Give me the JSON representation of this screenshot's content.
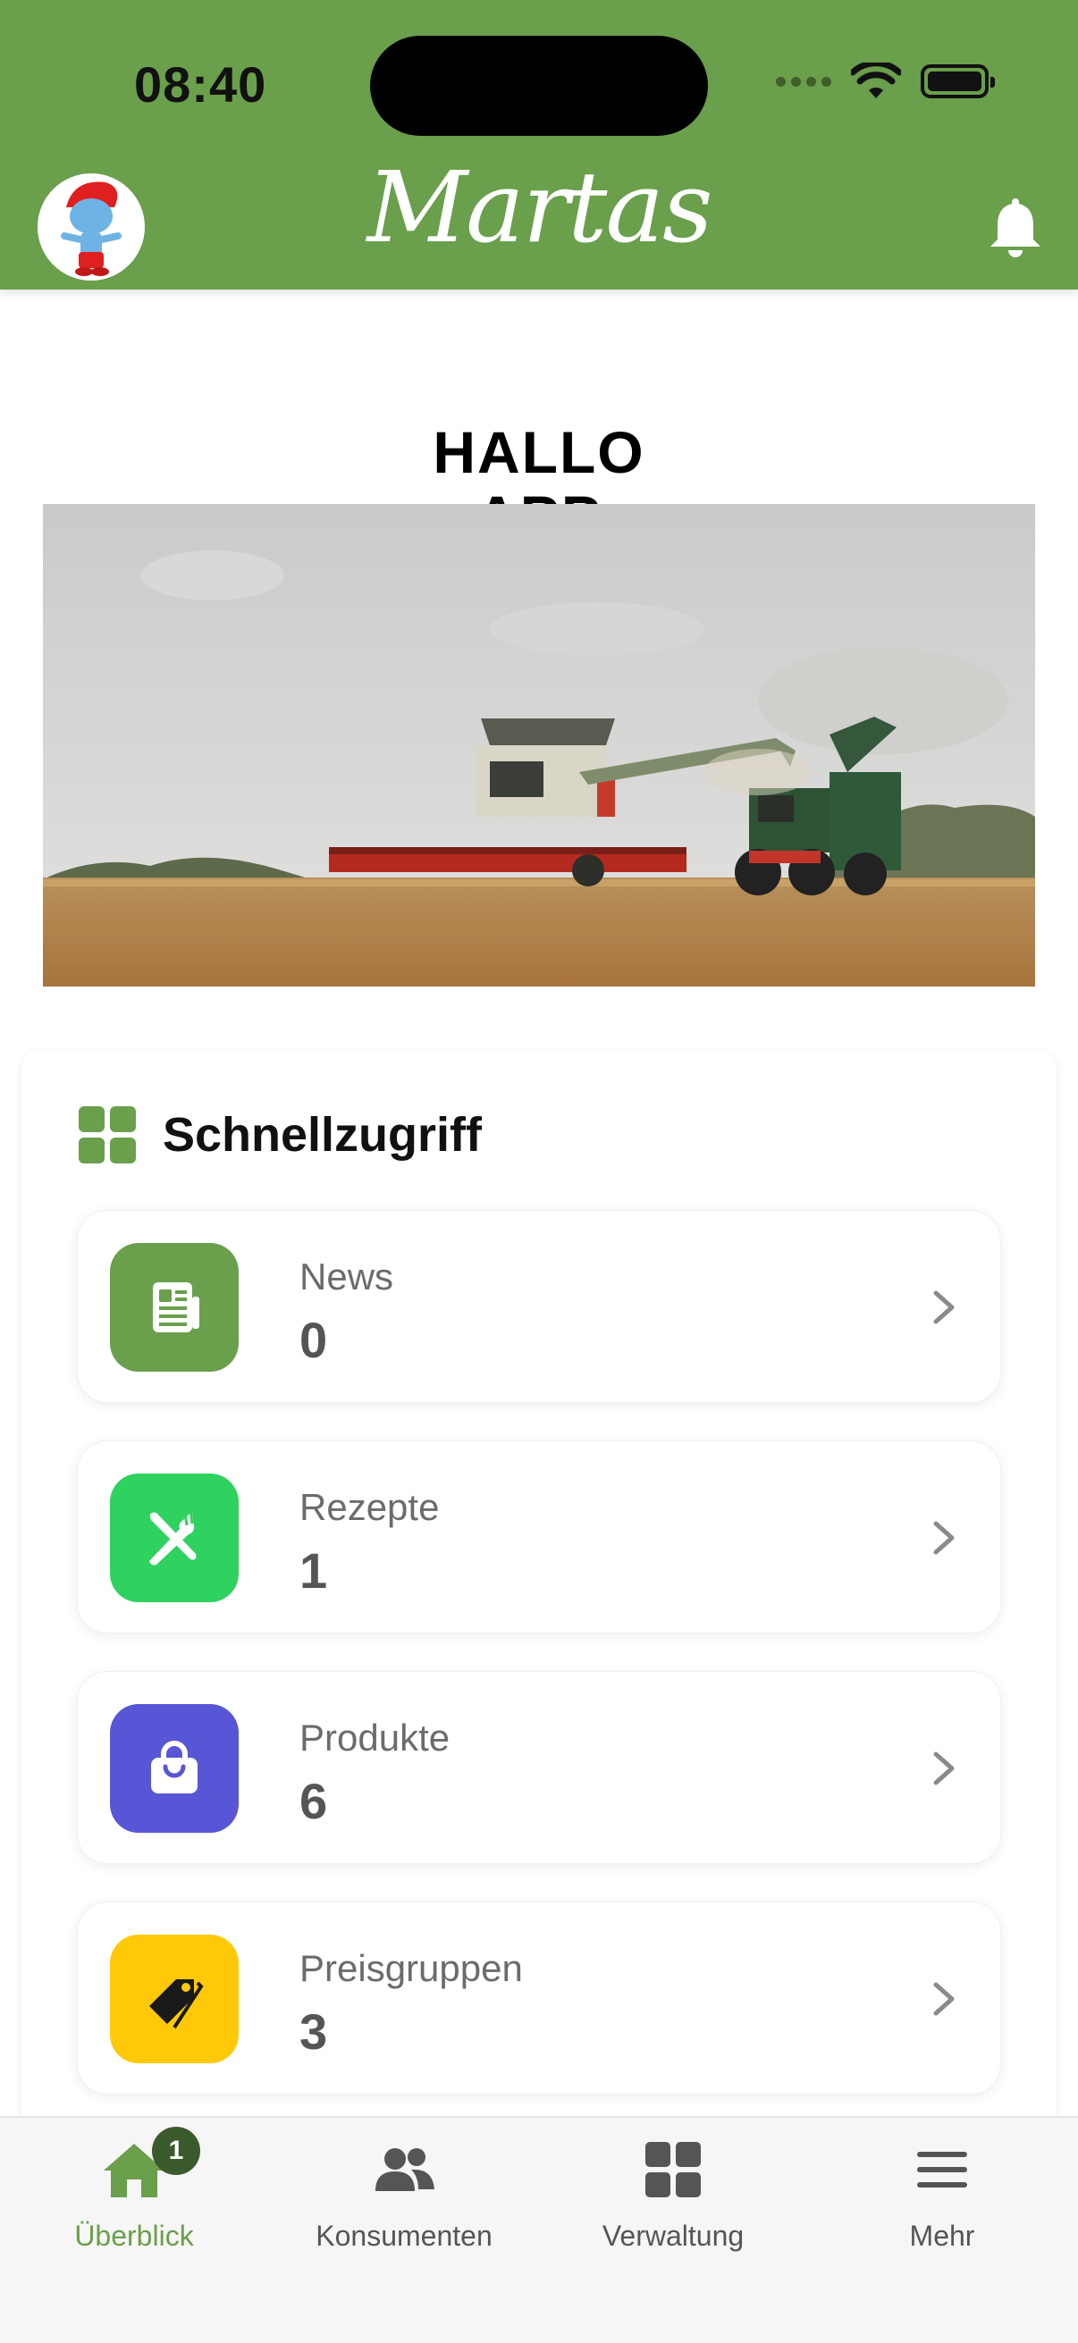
{
  "status_bar": {
    "time": "08:40"
  },
  "header": {
    "brand": "Martas"
  },
  "hero": {
    "title_line1": "HALLO",
    "title_line2": "APP"
  },
  "quick_access": {
    "title": "Schnellzugriff",
    "items": [
      {
        "label": "News",
        "value": "0",
        "icon": "newspaper-icon",
        "color": "#6a9f4b"
      },
      {
        "label": "Rezepte",
        "value": "1",
        "icon": "fork-knife-icon",
        "color": "#2fd15f"
      },
      {
        "label": "Produkte",
        "value": "6",
        "icon": "shopping-bag-icon",
        "color": "#5856d6"
      },
      {
        "label": "Preisgruppen",
        "value": "3",
        "icon": "price-tag-icon",
        "color": "#ffc90a"
      }
    ]
  },
  "tabbar": {
    "tabs": [
      {
        "label": "Überblick",
        "icon": "home-icon",
        "active": true,
        "badge": "1"
      },
      {
        "label": "Konsumenten",
        "icon": "users-icon",
        "active": false
      },
      {
        "label": "Verwaltung",
        "icon": "grid-icon",
        "active": false
      },
      {
        "label": "Mehr",
        "icon": "menu-icon",
        "active": false
      }
    ]
  },
  "colors": {
    "brand_green": "#6a9f4b",
    "badge_green": "#3b5a2c"
  }
}
